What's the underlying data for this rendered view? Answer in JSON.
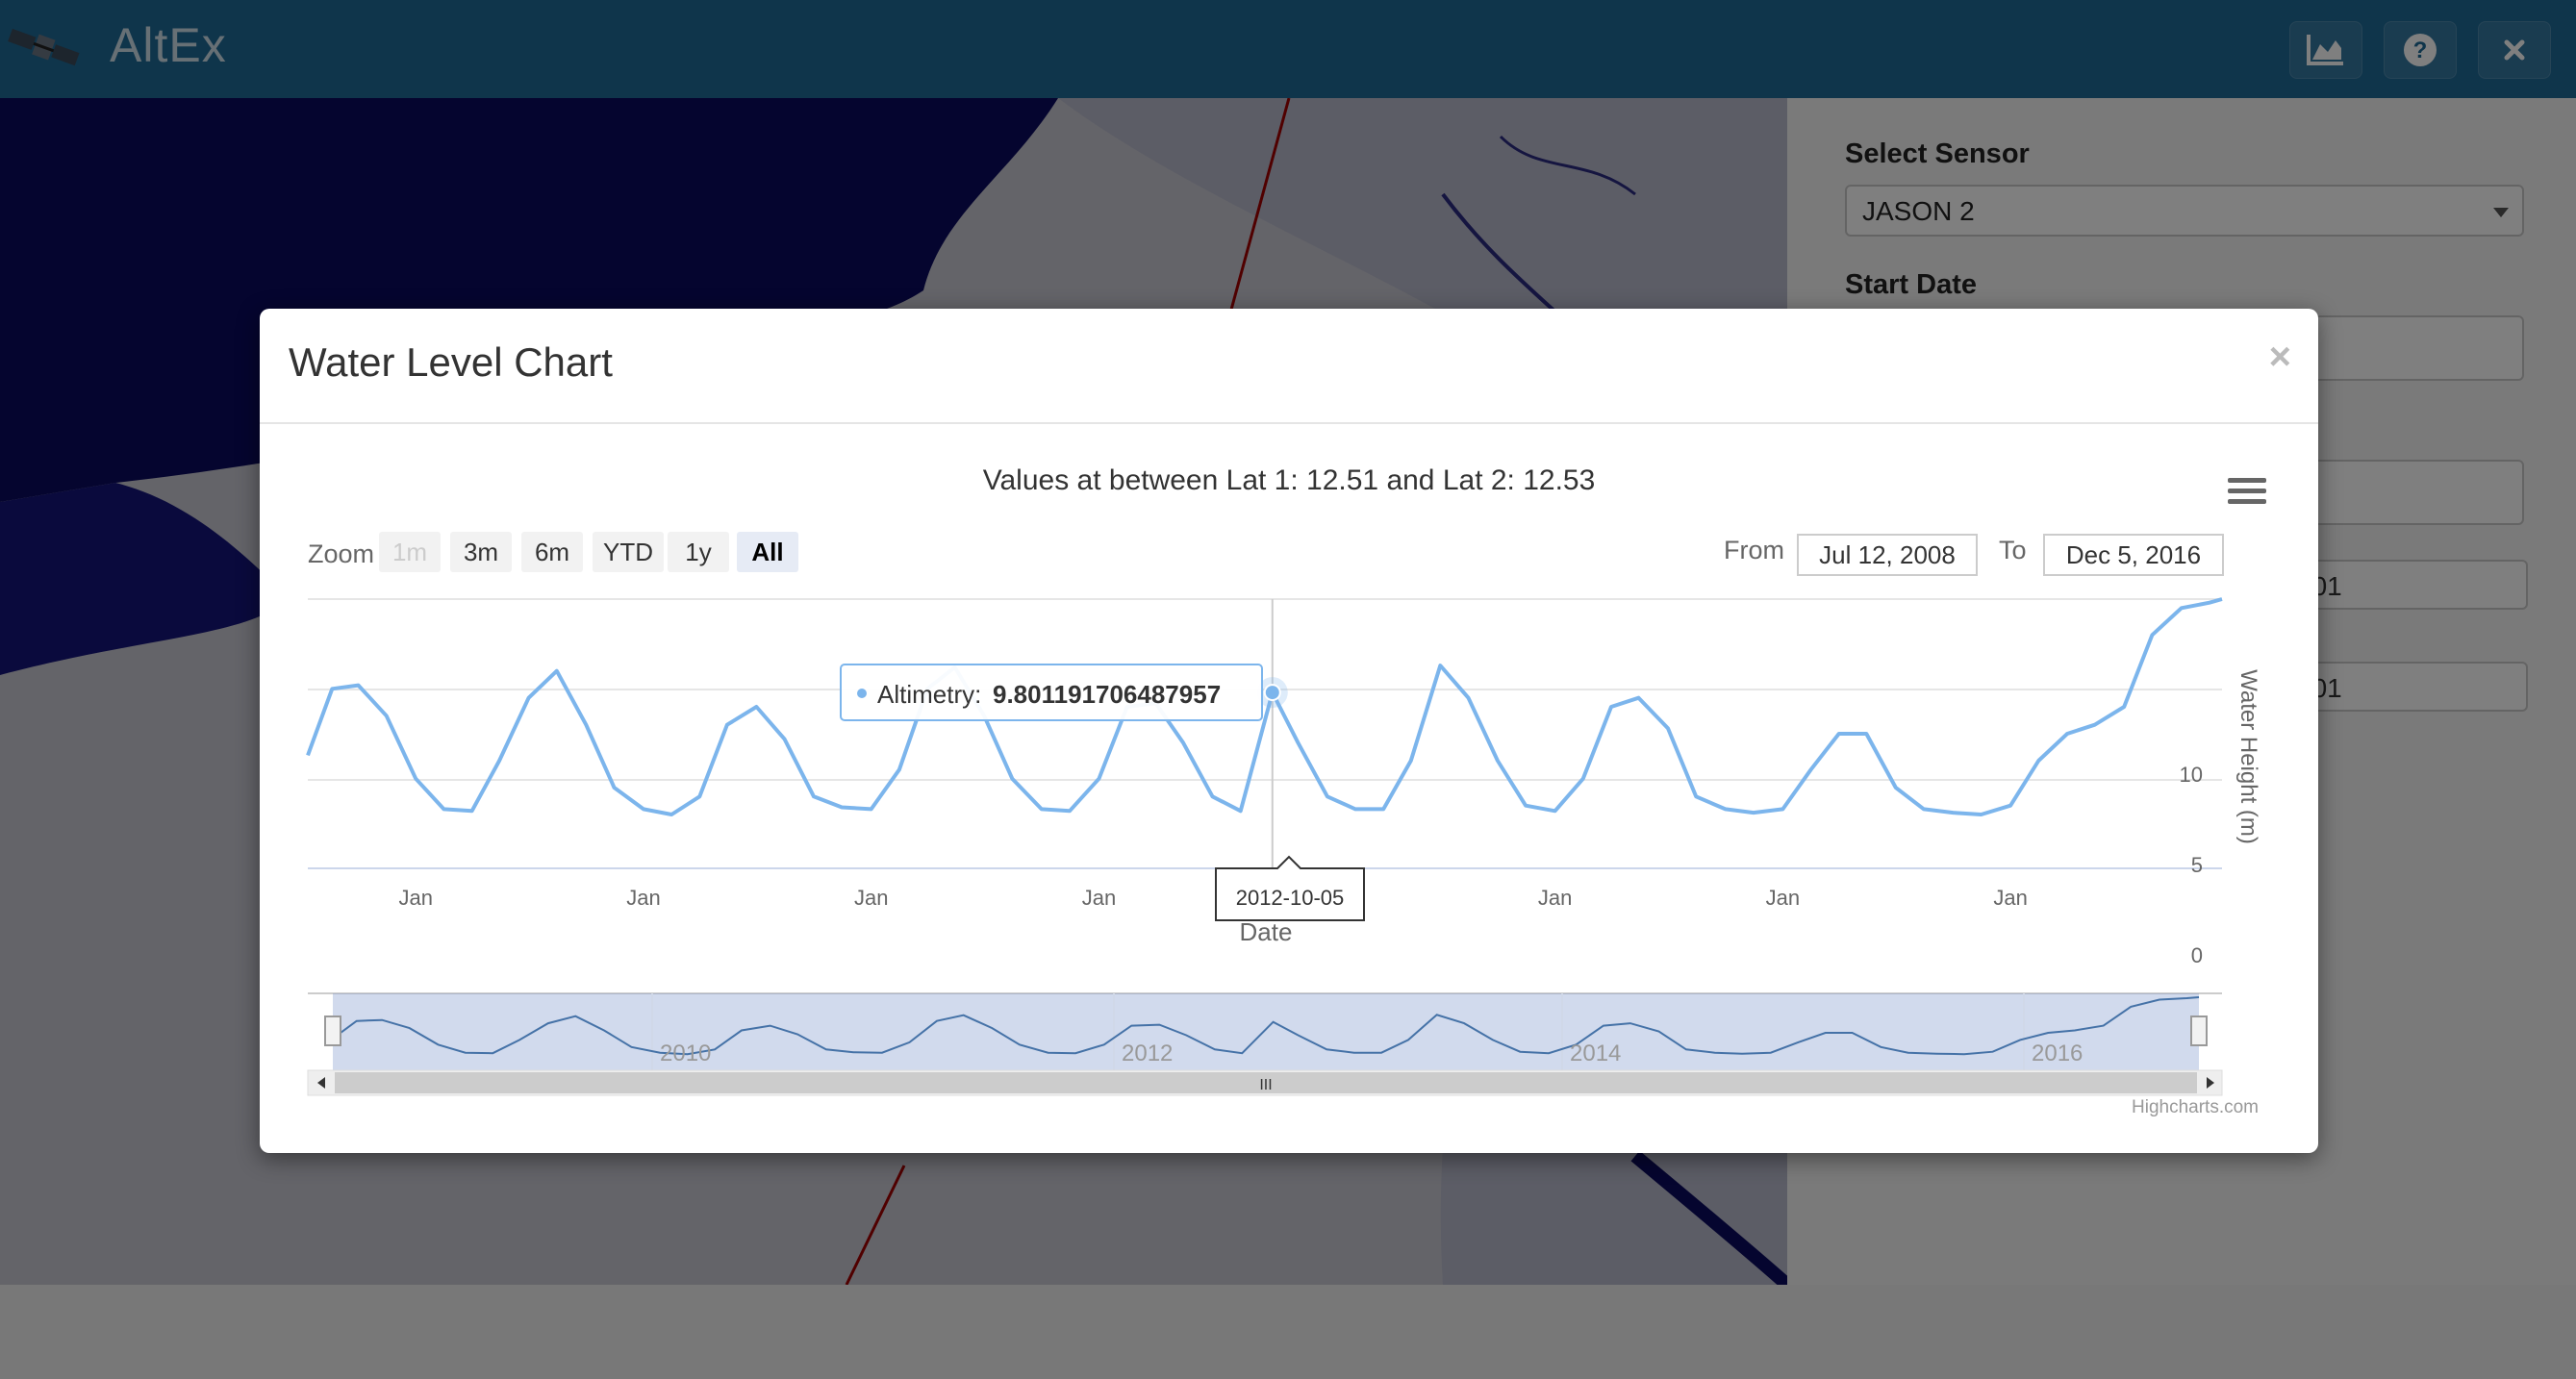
{
  "app": {
    "title": "AltEx"
  },
  "header": {
    "icons": [
      "chart-area-icon",
      "help-icon",
      "close-icon"
    ]
  },
  "sidebar": {
    "sensor_label": "Select Sensor",
    "sensor_value": "JASON 2",
    "start_date_label": "Start Date",
    "lat1_value_partial": "001",
    "lat2_value_partial": "001"
  },
  "modal": {
    "title": "Water Level Chart",
    "close_glyph": "×"
  },
  "chart": {
    "title": "Values at between Lat 1: 12.51 and Lat 2: 12.53",
    "zoom_label": "Zoom",
    "zoom_buttons": [
      "1m",
      "3m",
      "6m",
      "YTD",
      "1y",
      "All"
    ],
    "zoom_active": "All",
    "zoom_disabled": [
      "1m"
    ],
    "from_label": "From",
    "from_value": "Jul 12, 2008",
    "to_label": "To",
    "to_value": "Dec 5, 2016",
    "xlabel": "Date",
    "ylabel": "Water Height (m)",
    "tooltip_series": "Altimetry:",
    "tooltip_value": "9.801191706487957",
    "crosshair_label": "2012-10-05",
    "x_tick_labels": [
      "Jan",
      "Jan",
      "Jan",
      "Jan",
      "Jan",
      "Jan",
      "Jan"
    ],
    "y_tick_labels": [
      "0",
      "5",
      "10"
    ],
    "navigator_labels": [
      "2010",
      "2012",
      "2014",
      "2016"
    ],
    "navigator_scroll_glyph": "III",
    "credits": "Highcharts.com",
    "line_color": "#7cb5ec"
  },
  "chart_data": {
    "type": "line",
    "title": "Values at between Lat 1: 12.51 and Lat 2: 12.53",
    "xlabel": "Date",
    "ylabel": "Water Height (m)",
    "ylim": [
      0,
      15
    ],
    "x_range": [
      "2008-07-12",
      "2016-12-05"
    ],
    "grid": true,
    "legend": "none",
    "series": [
      {
        "name": "Altimetry",
        "x": [
          "2008-07-12",
          "2008-08-20",
          "2008-10-01",
          "2008-11-15",
          "2009-01-01",
          "2009-02-15",
          "2009-04-01",
          "2009-05-15",
          "2009-07-01",
          "2009-08-15",
          "2009-10-01",
          "2009-11-15",
          "2010-01-01",
          "2010-02-15",
          "2010-04-01",
          "2010-05-15",
          "2010-07-01",
          "2010-08-15",
          "2010-10-01",
          "2010-11-15",
          "2011-01-01",
          "2011-02-15",
          "2011-04-01",
          "2011-05-15",
          "2011-07-01",
          "2011-08-15",
          "2011-10-01",
          "2011-11-15",
          "2012-01-01",
          "2012-02-15",
          "2012-04-01",
          "2012-05-15",
          "2012-07-01",
          "2012-08-15",
          "2012-10-05",
          "2012-11-15",
          "2013-01-01",
          "2013-02-15",
          "2013-04-01",
          "2013-05-15",
          "2013-07-01",
          "2013-08-15",
          "2013-10-01",
          "2013-11-15",
          "2014-01-01",
          "2014-02-15",
          "2014-04-01",
          "2014-05-15",
          "2014-07-01",
          "2014-08-15",
          "2014-10-01",
          "2014-11-15",
          "2015-01-01",
          "2015-02-15",
          "2015-04-01",
          "2015-05-15",
          "2015-07-01",
          "2015-08-15",
          "2015-10-01",
          "2015-11-15",
          "2016-01-01",
          "2016-02-15",
          "2016-04-01",
          "2016-05-15",
          "2016-07-01",
          "2016-08-15",
          "2016-10-01",
          "2016-11-15",
          "2016-12-05"
        ],
        "y": [
          6.3,
          10.0,
          10.2,
          8.5,
          5.0,
          3.3,
          3.2,
          6.0,
          9.5,
          11.0,
          8.0,
          4.5,
          3.3,
          3.0,
          4.0,
          8.0,
          9.0,
          7.2,
          4.0,
          3.4,
          3.3,
          5.5,
          10.0,
          11.2,
          8.5,
          5.0,
          3.3,
          3.2,
          5.0,
          9.0,
          9.2,
          7.0,
          4.0,
          3.2,
          9.8,
          7.0,
          4.0,
          3.3,
          3.3,
          6.0,
          11.3,
          9.5,
          6.0,
          3.5,
          3.2,
          5.0,
          9.0,
          9.5,
          7.8,
          4.0,
          3.3,
          3.1,
          3.3,
          5.5,
          7.5,
          7.5,
          4.5,
          3.3,
          3.1,
          3.0,
          3.5,
          6.0,
          7.5,
          8.0,
          9.0,
          13.0,
          14.5,
          14.8,
          15.0
        ]
      }
    ]
  }
}
